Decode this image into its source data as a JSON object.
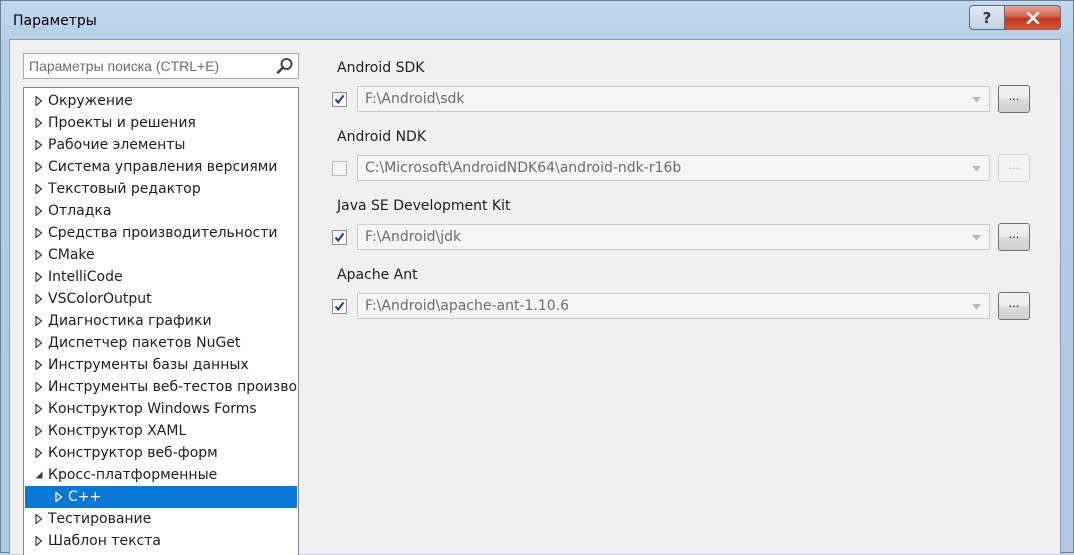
{
  "window": {
    "title": "Параметры"
  },
  "titlebar": {
    "help_label": "?"
  },
  "search": {
    "placeholder": "Параметры поиска (CTRL+E)"
  },
  "tree": {
    "items": [
      {
        "label": "Окружение",
        "expanded": false,
        "level": 0
      },
      {
        "label": "Проекты и решения",
        "expanded": false,
        "level": 0
      },
      {
        "label": "Рабочие элементы",
        "expanded": false,
        "level": 0
      },
      {
        "label": "Система управления версиями",
        "expanded": false,
        "level": 0
      },
      {
        "label": "Текстовый редактор",
        "expanded": false,
        "level": 0
      },
      {
        "label": "Отладка",
        "expanded": false,
        "level": 0
      },
      {
        "label": "Средства производительности",
        "expanded": false,
        "level": 0
      },
      {
        "label": "CMake",
        "expanded": false,
        "level": 0
      },
      {
        "label": "IntelliCode",
        "expanded": false,
        "level": 0
      },
      {
        "label": "VSColorOutput",
        "expanded": false,
        "level": 0
      },
      {
        "label": "Диагностика графики",
        "expanded": false,
        "level": 0
      },
      {
        "label": "Диспетчер пакетов NuGet",
        "expanded": false,
        "level": 0
      },
      {
        "label": "Инструменты базы данных",
        "expanded": false,
        "level": 0
      },
      {
        "label": "Инструменты веб-тестов производи",
        "expanded": false,
        "level": 0
      },
      {
        "label": "Конструктор Windows Forms",
        "expanded": false,
        "level": 0
      },
      {
        "label": "Конструктор XAML",
        "expanded": false,
        "level": 0
      },
      {
        "label": "Конструктор веб-форм",
        "expanded": false,
        "level": 0
      },
      {
        "label": "Кросс-платформенные",
        "expanded": true,
        "level": 0
      },
      {
        "label": "C++",
        "expanded": false,
        "level": 1,
        "selected": true
      },
      {
        "label": "Тестирование",
        "expanded": false,
        "level": 0
      },
      {
        "label": "Шаблон текста",
        "expanded": false,
        "level": 0
      }
    ]
  },
  "settings": {
    "sections": [
      {
        "label": "Android SDK",
        "checked": true,
        "enabled": true,
        "path": "F:\\Android\\sdk",
        "browse_label": "..."
      },
      {
        "label": "Android NDK",
        "checked": false,
        "enabled": false,
        "path": "C:\\Microsoft\\AndroidNDK64\\android-ndk-r16b",
        "browse_label": "..."
      },
      {
        "label": "Java SE Development Kit",
        "checked": true,
        "enabled": true,
        "path": "F:\\Android\\jdk",
        "browse_label": "..."
      },
      {
        "label": "Apache Ant",
        "checked": true,
        "enabled": true,
        "path": "F:\\Android\\apache-ant-1.10.6",
        "browse_label": "..."
      }
    ]
  },
  "colors": {
    "selection": "#0a78d7",
    "accent_close": "#c2371c",
    "check": "#1f3a93"
  }
}
